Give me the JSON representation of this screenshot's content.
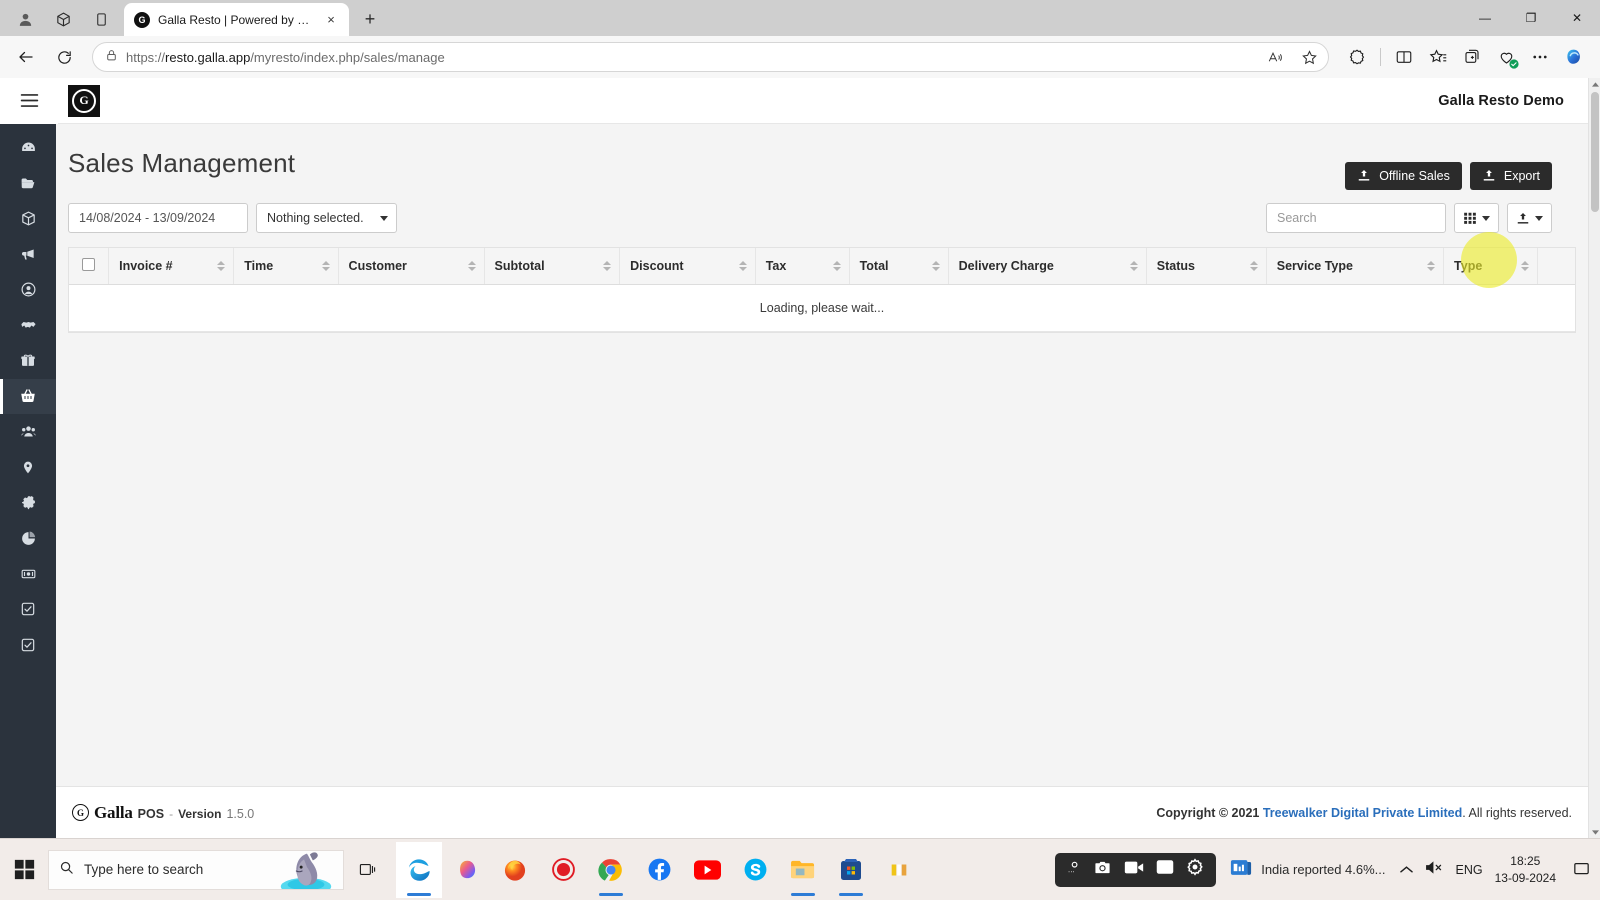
{
  "browser": {
    "tab": {
      "title": "Galla Resto | Powered by Galla",
      "favicon_letter": "G"
    },
    "url_scheme": "https://",
    "url_host": "resto.galla.app",
    "url_path": "/myresto/index.php/sales/manage",
    "new_tab_label": "+",
    "tab_close_label": "×",
    "win_minimize": "—",
    "win_maximize": "❐",
    "win_close": "✕",
    "icons": {
      "profile": "profile-icon",
      "workspaces": "workspaces-icon",
      "tab_actions": "tab-actions-icon",
      "back": "back-arrow-icon",
      "refresh": "refresh-icon",
      "lock": "lock-icon",
      "read_aloud": "read-aloud-icon",
      "favorite": "star-icon",
      "extensions": "extensions-icon",
      "split_screen": "split-screen-icon",
      "favorites_bar": "favorites-icon",
      "collections": "collections-icon",
      "browser_essentials": "browser-essentials-icon",
      "settings_more": "more-options-icon",
      "copilot": "copilot-icon"
    }
  },
  "app": {
    "store_name": "Galla Resto Demo",
    "logo_letter": "G",
    "page_title": "Sales Management",
    "actions": [
      {
        "id": "offline-sales",
        "label": "Offline Sales",
        "icon": "upload-icon"
      },
      {
        "id": "export",
        "label": "Export",
        "icon": "upload-icon"
      }
    ],
    "filters": {
      "date_range": "14/08/2024 - 13/09/2024",
      "multiselect_label": "Nothing selected."
    },
    "search": {
      "placeholder": "Search",
      "value": ""
    },
    "tools": [
      {
        "id": "columns",
        "icon": "grid-icon",
        "caret": true
      },
      {
        "id": "export-tool",
        "icon": "upload-icon",
        "caret": true
      }
    ],
    "table": {
      "columns": [
        "Invoice #",
        "Time",
        "Customer",
        "Subtotal",
        "Discount",
        "Tax",
        "Total",
        "Delivery Charge",
        "Status",
        "Service Type",
        "Type"
      ],
      "rows": [],
      "empty_message": "Loading, please wait..."
    },
    "sidebar": [
      {
        "id": "dashboard",
        "icon": "dashboard-icon",
        "active": false
      },
      {
        "id": "catalog",
        "icon": "folder-icon",
        "active": false
      },
      {
        "id": "inventory",
        "icon": "box-icon",
        "active": false
      },
      {
        "id": "marketing",
        "icon": "megaphone-icon",
        "active": false
      },
      {
        "id": "customers",
        "icon": "user-circle-icon",
        "active": false
      },
      {
        "id": "suppliers",
        "icon": "handshake-icon",
        "active": false
      },
      {
        "id": "loyalty",
        "icon": "gift-icon",
        "active": false
      },
      {
        "id": "sales",
        "icon": "basket-icon",
        "active": true
      },
      {
        "id": "staff",
        "icon": "users-icon",
        "active": false
      },
      {
        "id": "outlets",
        "icon": "location-pin-icon",
        "active": false
      },
      {
        "id": "settings",
        "icon": "gear-icon",
        "active": false
      },
      {
        "id": "reports",
        "icon": "pie-chart-icon",
        "active": false
      },
      {
        "id": "payments",
        "icon": "cash-icon",
        "active": false
      },
      {
        "id": "tasks",
        "icon": "check-square-icon",
        "active": false
      },
      {
        "id": "approvals",
        "icon": "check-square-icon",
        "active": false
      }
    ],
    "footer": {
      "logo_letter": "G",
      "brand": "Galla",
      "product": "POS",
      "dash": "-",
      "version_label": "Version",
      "version_number": "1.5.0",
      "copyright_prefix": "Copyright © 2021",
      "company": "Treewalker Digital Private Limited",
      "copyright_suffix": ". All rights reserved."
    }
  },
  "taskbar": {
    "search_placeholder": "Type here to search",
    "apps": [
      {
        "id": "edge",
        "name": "edge-icon",
        "active": true
      },
      {
        "id": "copilot",
        "name": "copilot-icon",
        "active": false
      },
      {
        "id": "firefox",
        "name": "firefox-icon",
        "active": false
      },
      {
        "id": "recorder",
        "name": "screen-recorder-icon",
        "active": false
      },
      {
        "id": "chrome",
        "name": "chrome-icon",
        "active": true
      },
      {
        "id": "facebook",
        "name": "facebook-icon",
        "active": false
      },
      {
        "id": "youtube",
        "name": "youtube-icon",
        "active": false
      },
      {
        "id": "skype",
        "name": "skype-icon",
        "active": true
      },
      {
        "id": "explorer",
        "name": "file-explorer-icon",
        "active": true
      },
      {
        "id": "store",
        "name": "microsoft-store-icon",
        "active": true
      },
      {
        "id": "misc",
        "name": "app-icon",
        "active": false
      }
    ],
    "news": "India reported 4.6%...",
    "language": "ENG",
    "time": "18:25",
    "date": "13-09-2024"
  }
}
